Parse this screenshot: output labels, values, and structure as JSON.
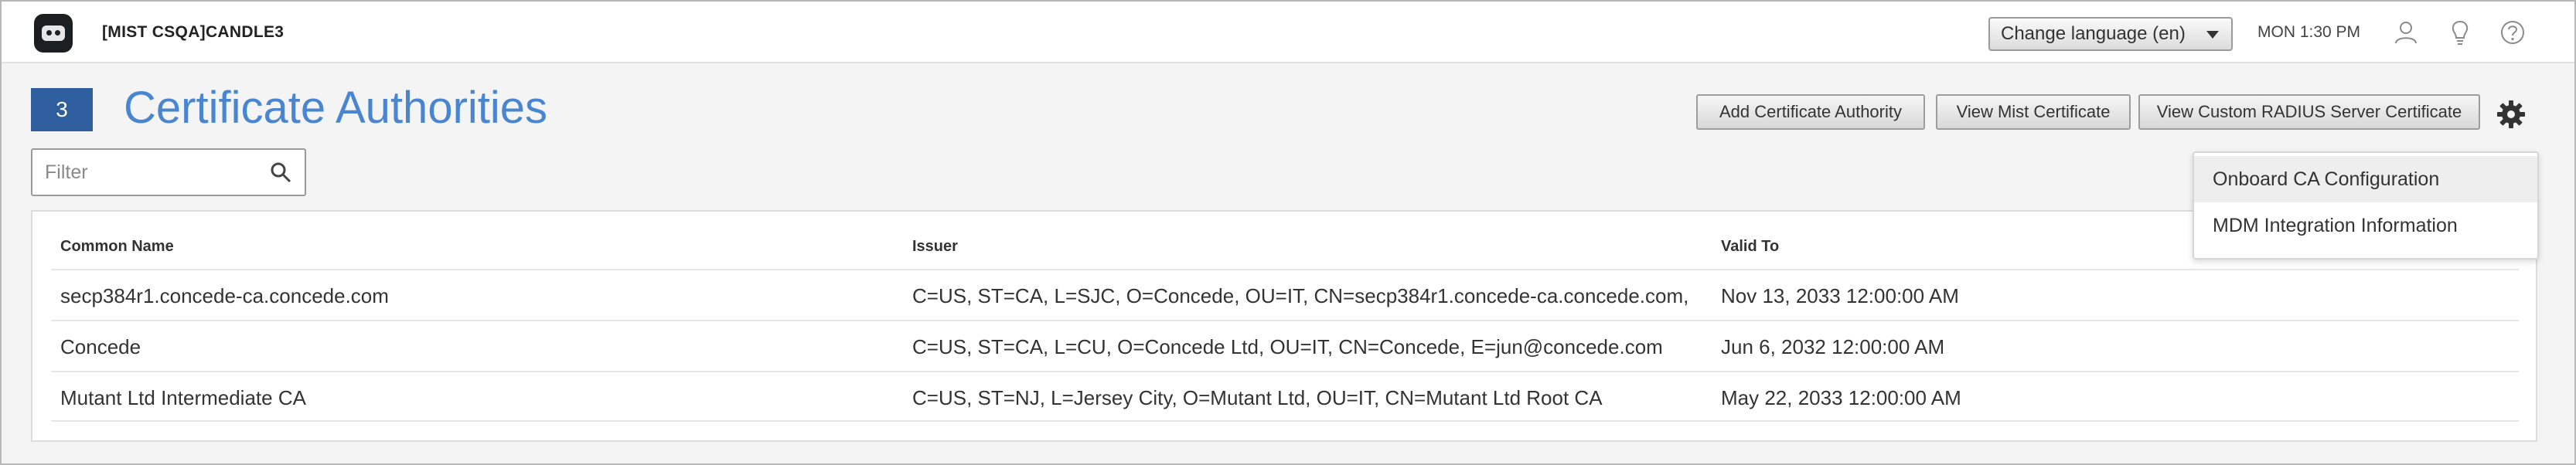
{
  "header": {
    "org_name": "[MIST CSQA]CANDLE3",
    "language_select": "Change language (en)",
    "clock": "MON 1:30 PM",
    "icons": [
      "user-icon",
      "lightbulb-icon",
      "help-icon"
    ]
  },
  "page": {
    "count": "3",
    "title": "Certificate Authorities"
  },
  "toolbar": {
    "add_ca": "Add Certificate Authority",
    "view_mist": "View Mist Certificate",
    "view_radius": "View Custom RADIUS Server Certificate"
  },
  "filter": {
    "placeholder": "Filter"
  },
  "table": {
    "headers": [
      "Common Name",
      "Issuer",
      "Valid To"
    ],
    "rows": [
      {
        "common_name": "secp384r1.concede-ca.concede.com",
        "issuer": "C=US, ST=CA, L=SJC, O=Concede, OU=IT, CN=secp384r1.concede-ca.concede.com, ...",
        "valid_to": "Nov 13, 2033 12:00:00 AM"
      },
      {
        "common_name": "Concede",
        "issuer": "C=US, ST=CA, L=CU, O=Concede Ltd, OU=IT, CN=Concede, E=jun@concede.com",
        "valid_to": "Jun 6, 2032 12:00:00 AM"
      },
      {
        "common_name": "Mutant Ltd Intermediate CA",
        "issuer": "C=US, ST=NJ, L=Jersey City, O=Mutant Ltd, OU=IT, CN=Mutant Ltd Root CA",
        "valid_to": "May 22, 2033 12:00:00 AM"
      }
    ]
  },
  "settings_menu": {
    "items": [
      "Onboard CA Configuration",
      "MDM Integration Information"
    ]
  },
  "colors": {
    "accent": "#4a86cf",
    "badge": "#2e5e9e"
  }
}
